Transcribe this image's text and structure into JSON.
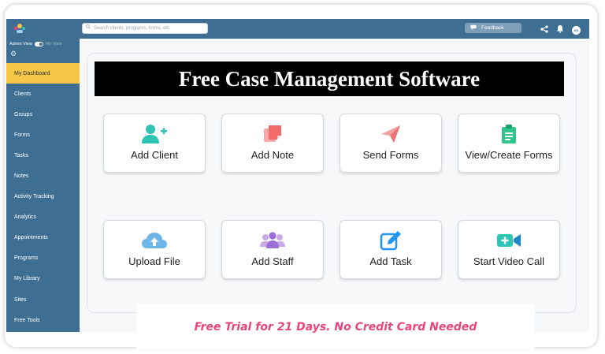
{
  "topbar": {
    "search_placeholder": "Search clients, programs, forms, etc.",
    "feedback_label": "Feedback",
    "avatar_initials": "SS"
  },
  "sidebar": {
    "admin_view_label": "Admin View",
    "my_view_label": "My View",
    "items": [
      {
        "label": "My Dashboard",
        "active": true
      },
      {
        "label": "Clients"
      },
      {
        "label": "Groups"
      },
      {
        "label": "Forms"
      },
      {
        "label": "Tasks"
      },
      {
        "label": "Notes"
      },
      {
        "label": "Activity Tracking"
      },
      {
        "label": "Analytics"
      },
      {
        "label": "Appointments"
      },
      {
        "label": "Programs"
      },
      {
        "label": "My Library"
      },
      {
        "label": "Sites"
      },
      {
        "label": "Free Tools"
      }
    ]
  },
  "banner": {
    "title": "Free Case Management Software"
  },
  "actions": [
    {
      "label": "Add Client",
      "icon": "add-user-icon"
    },
    {
      "label": "Add Note",
      "icon": "note-icon"
    },
    {
      "label": "Send Forms",
      "icon": "paper-plane-icon"
    },
    {
      "label": "View/Create Forms",
      "icon": "clipboard-icon"
    },
    {
      "label": "Upload File",
      "icon": "cloud-upload-icon"
    },
    {
      "label": "Add Staff",
      "icon": "staff-group-icon"
    },
    {
      "label": "Add Task",
      "icon": "edit-task-icon"
    },
    {
      "label": "Start Video Call",
      "icon": "video-call-icon"
    }
  ],
  "promo": {
    "text": "Free Trial for 21 Days. No Credit Card Needed"
  },
  "colors": {
    "sidebar_bg": "#3e6f92",
    "active_item": "#f7c647",
    "promo_text": "#e8457a",
    "teal": "#2ec4b6",
    "coral": "#f26b6b",
    "blue": "#2196f3"
  }
}
